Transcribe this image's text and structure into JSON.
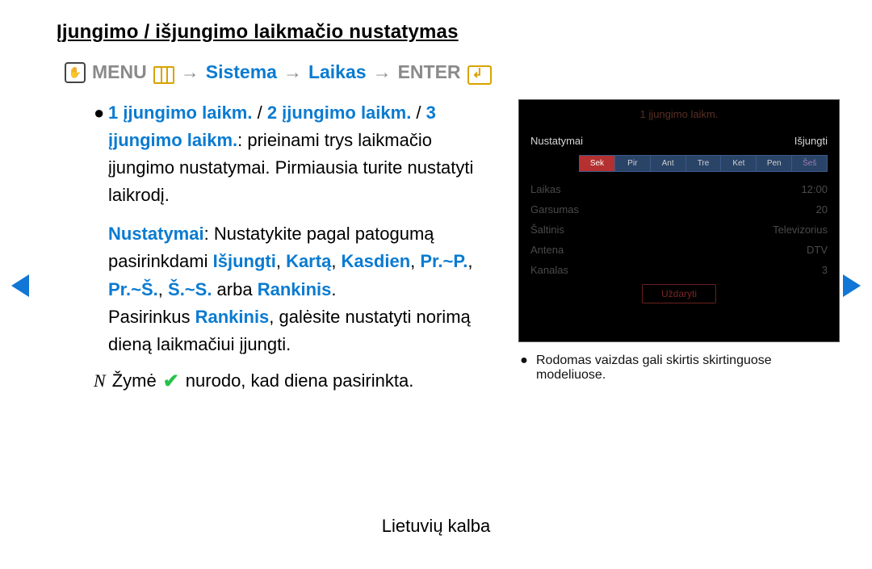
{
  "title": "Įjungimo / išjungimo laikmačio nustatymas",
  "breadcrumb": {
    "menu": "MENU",
    "path1": "Sistema",
    "path2": "Laikas",
    "enter": "ENTER"
  },
  "body": {
    "timer1": "1 įjungimo laikm.",
    "slash1": " / ",
    "timer2": "2 įjungimo laikm.",
    "slash2": " / ",
    "timer3": "3 įjungimo laikm.",
    "timer_tail": ": prieinami trys laikmačio įjungimo nustatymai. Pirmiausia turite nustatyti laikrodį.",
    "nustatymai_label": "Nustatymai",
    "nustatymai_text1": ": Nustatykite pagal patogumą pasirinkdami ",
    "opt_isjungti": "Išjungti",
    "sep": ", ",
    "opt_karta": "Kartą",
    "opt_kasdien": "Kasdien",
    "opt_prp": "Pr.~P.",
    "opt_prs": "Pr.~Š.",
    "opt_ss": "Š.~S.",
    "arba": " arba ",
    "opt_rankinis": "Rankinis",
    "period": ".",
    "rankinis_sentence_pre": "Pasirinkus ",
    "rankinis_sentence_post": ", galėsite nustatyti norimą dieną laikmačiui įjungti.",
    "note_n": "N",
    "note_pre": "Žymė",
    "note_post": "nurodo, kad diena pasirinkta."
  },
  "panel": {
    "title": "1 įjungimo laikm.",
    "row_setup_label": "Nustatymai",
    "row_setup_value": "Išjungti",
    "days": [
      "Sek",
      "Pir",
      "Ant",
      "Tre",
      "Ket",
      "Pen",
      "Šeš"
    ],
    "rows": [
      {
        "label": "Laikas",
        "value": "12:00"
      },
      {
        "label": "Garsumas",
        "value": "20"
      },
      {
        "label": "Šaltinis",
        "value": "Televizorius"
      },
      {
        "label": "Antena",
        "value": "DTV"
      },
      {
        "label": "Kanalas",
        "value": "3"
      }
    ],
    "close": "Uždaryti",
    "note": "Rodomas vaizdas gali skirtis skirtinguose modeliuose."
  },
  "footer": "Lietuvių kalba"
}
